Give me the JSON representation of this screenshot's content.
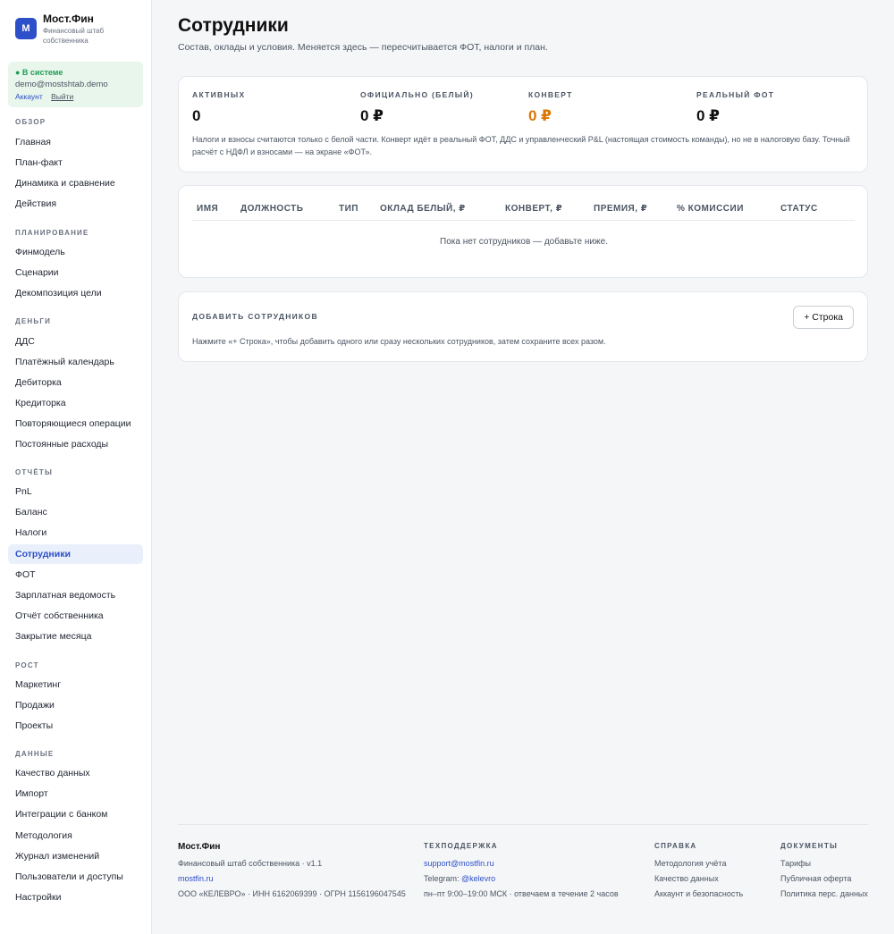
{
  "brand": {
    "logo": "М",
    "name": "Мост.Фин",
    "subtitle": "Финансовый штаб собственника"
  },
  "session": {
    "status": "● В системе",
    "email": "demo@mostshtab.demo",
    "account_link": "Аккаунт",
    "logout_link": "Выйти"
  },
  "nav": {
    "sections": [
      {
        "title": "Обзор",
        "items": [
          "Главная",
          "План-факт",
          "Динамика и сравнение",
          "Действия"
        ]
      },
      {
        "title": "Планирование",
        "items": [
          "Финмодель",
          "Сценарии",
          "Декомпозиция цели"
        ]
      },
      {
        "title": "Деньги",
        "items": [
          "ДДС",
          "Платёжный календарь",
          "Дебиторка",
          "Кредиторка",
          "Повторяющиеся операции",
          "Постоянные расходы"
        ]
      },
      {
        "title": "Отчёты",
        "items": [
          "PnL",
          "Баланс",
          "Налоги",
          "Сотрудники",
          "ФОТ",
          "Зарплатная ведомость",
          "Отчёт собственника",
          "Закрытие месяца"
        ]
      },
      {
        "title": "Рост",
        "items": [
          "Маркетинг",
          "Продажи",
          "Проекты"
        ]
      },
      {
        "title": "Данные",
        "items": [
          "Качество данных",
          "Импорт",
          "Интеграции с банком",
          "Методология",
          "Журнал изменений",
          "Пользователи и доступы",
          "Настройки"
        ]
      }
    ],
    "active_item": "Сотрудники"
  },
  "page": {
    "title": "Сотрудники",
    "subtitle": "Состав, оклады и условия. Меняется здесь — пересчитывается ФОТ, налоги и план."
  },
  "stats": {
    "items": [
      {
        "label": "Активных",
        "value": "0"
      },
      {
        "label": "Официально (белый)",
        "value": "0 ₽"
      },
      {
        "label": "Конверт",
        "value": "0 ₽"
      },
      {
        "label": "Реальный ФОТ",
        "value": "0 ₽"
      }
    ],
    "note": "Налоги и взносы считаются только с белой части. Конверт идёт в реальный ФОТ, ДДС и управленческий P&L (настоящая стоимость команды), но не в налоговую базу. Точный расчёт с НДФЛ и взносами — на экране «ФОТ».",
    "accent_color": "#d97706"
  },
  "table": {
    "columns": [
      "Имя",
      "Должность",
      "Тип",
      "Оклад белый, ₽",
      "Конверт, ₽",
      "Премия, ₽",
      "% комиссии",
      "Статус"
    ],
    "empty_text": "Пока нет сотрудников — добавьте ниже."
  },
  "add": {
    "title": "Добавить сотрудников",
    "button": "+ Строка",
    "note": "Нажмите «+ Строка», чтобы добавить одного или сразу нескольких сотрудников, затем сохраните всех разом."
  },
  "footer": {
    "brand": {
      "name": "Мост.Фин",
      "tagline": "Финансовый штаб собственника · v1.1",
      "site": "mostfin.ru",
      "legal": "ООО «КЕЛЕВРО» · ИНН 6162069399 · ОГРН 1156196047545"
    },
    "support": {
      "title": "Техподдержка",
      "email": "support@mostfin.ru",
      "telegram_label": "Telegram:",
      "telegram": "@kelevro",
      "hours": "пн–пт 9:00–19:00 МСК · отвечаем в течение 2 часов"
    },
    "help": {
      "title": "Справка",
      "links": [
        "Методология учёта",
        "Качество данных",
        "Аккаунт и безопасность"
      ]
    },
    "docs": {
      "title": "Документы",
      "links": [
        "Тарифы",
        "Публичная оферта",
        "Политика перс. данных"
      ]
    }
  }
}
